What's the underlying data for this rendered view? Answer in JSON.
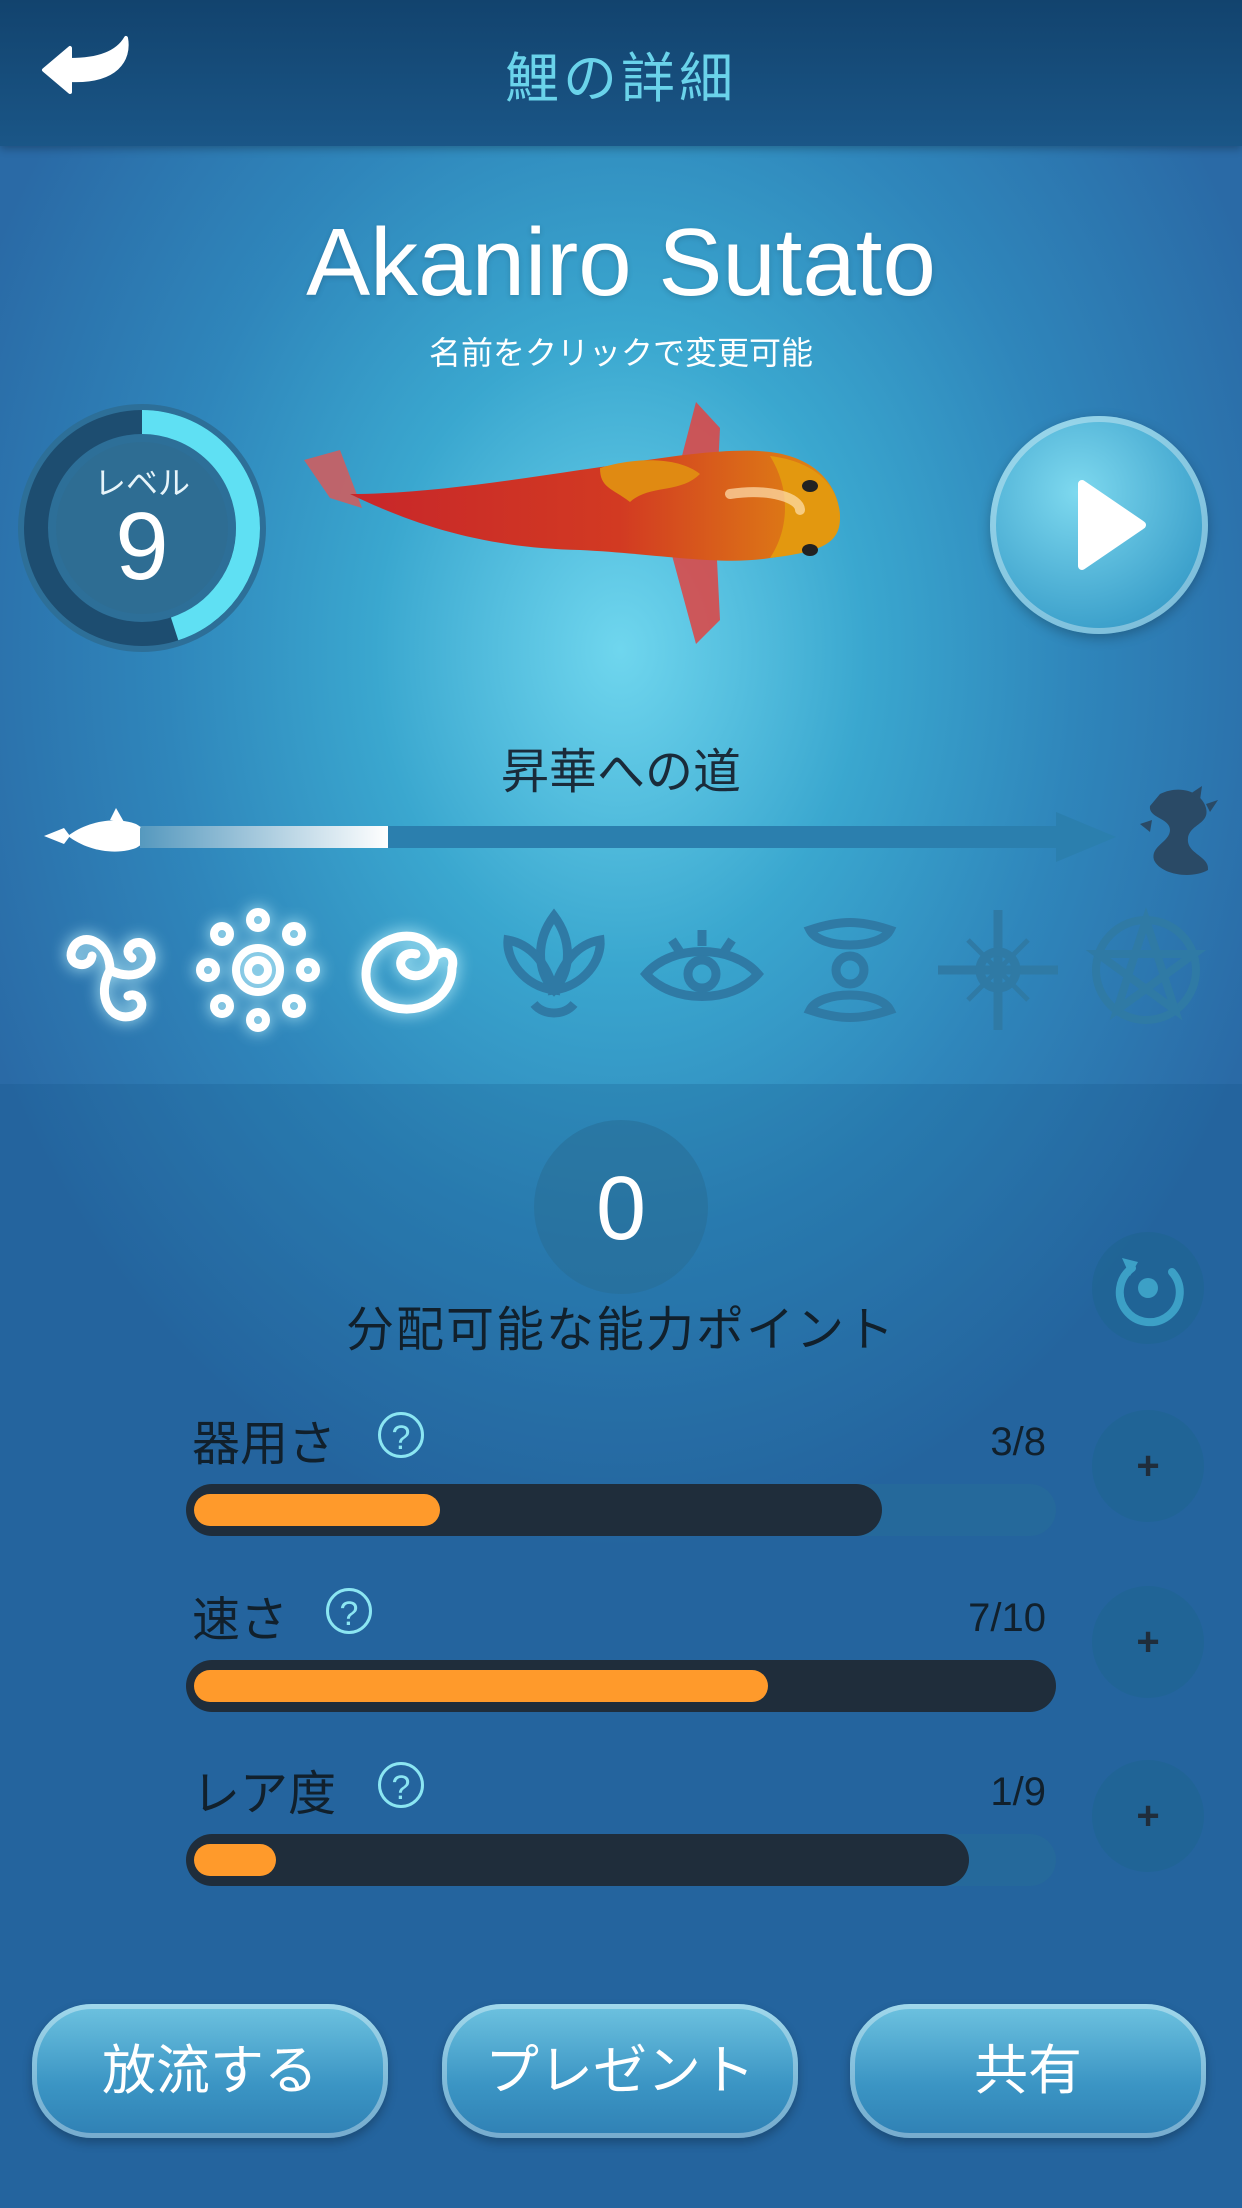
{
  "header": {
    "title": "鯉の詳細"
  },
  "koi": {
    "name": "Akaniro Sutato",
    "rename_hint": "名前をクリックで変更可能"
  },
  "level": {
    "label": "レベル",
    "value": "9",
    "progress": 0.45
  },
  "path": {
    "title": "昇華への道",
    "progress": 0.27,
    "milestones_total": 8,
    "milestones_unlocked": 3
  },
  "points": {
    "value": "0",
    "label": "分配可能な能力ポイント"
  },
  "stats": [
    {
      "label": "器用さ",
      "value_text": "3/8",
      "current": 3,
      "cap": 8,
      "max": 10
    },
    {
      "label": "速さ",
      "value_text": "7/10",
      "current": 7,
      "cap": 10,
      "max": 10
    },
    {
      "label": "レア度",
      "value_text": "1/9",
      "current": 1,
      "cap": 9,
      "max": 10
    }
  ],
  "stat_add_label": "+",
  "help_label": "?",
  "buttons": {
    "release": "放流する",
    "gift": "プレゼント",
    "share": "共有"
  },
  "colors": {
    "accent": "#6ad3ea",
    "stat_fill": "#ff9a2b",
    "stat_cap": "#1f2d3b",
    "koi_red": "#c7262a",
    "koi_orange": "#e08a12"
  },
  "icons": [
    "back-arrow-icon",
    "play-icon",
    "reset-icon",
    "fish-icon",
    "dragon-icon"
  ]
}
